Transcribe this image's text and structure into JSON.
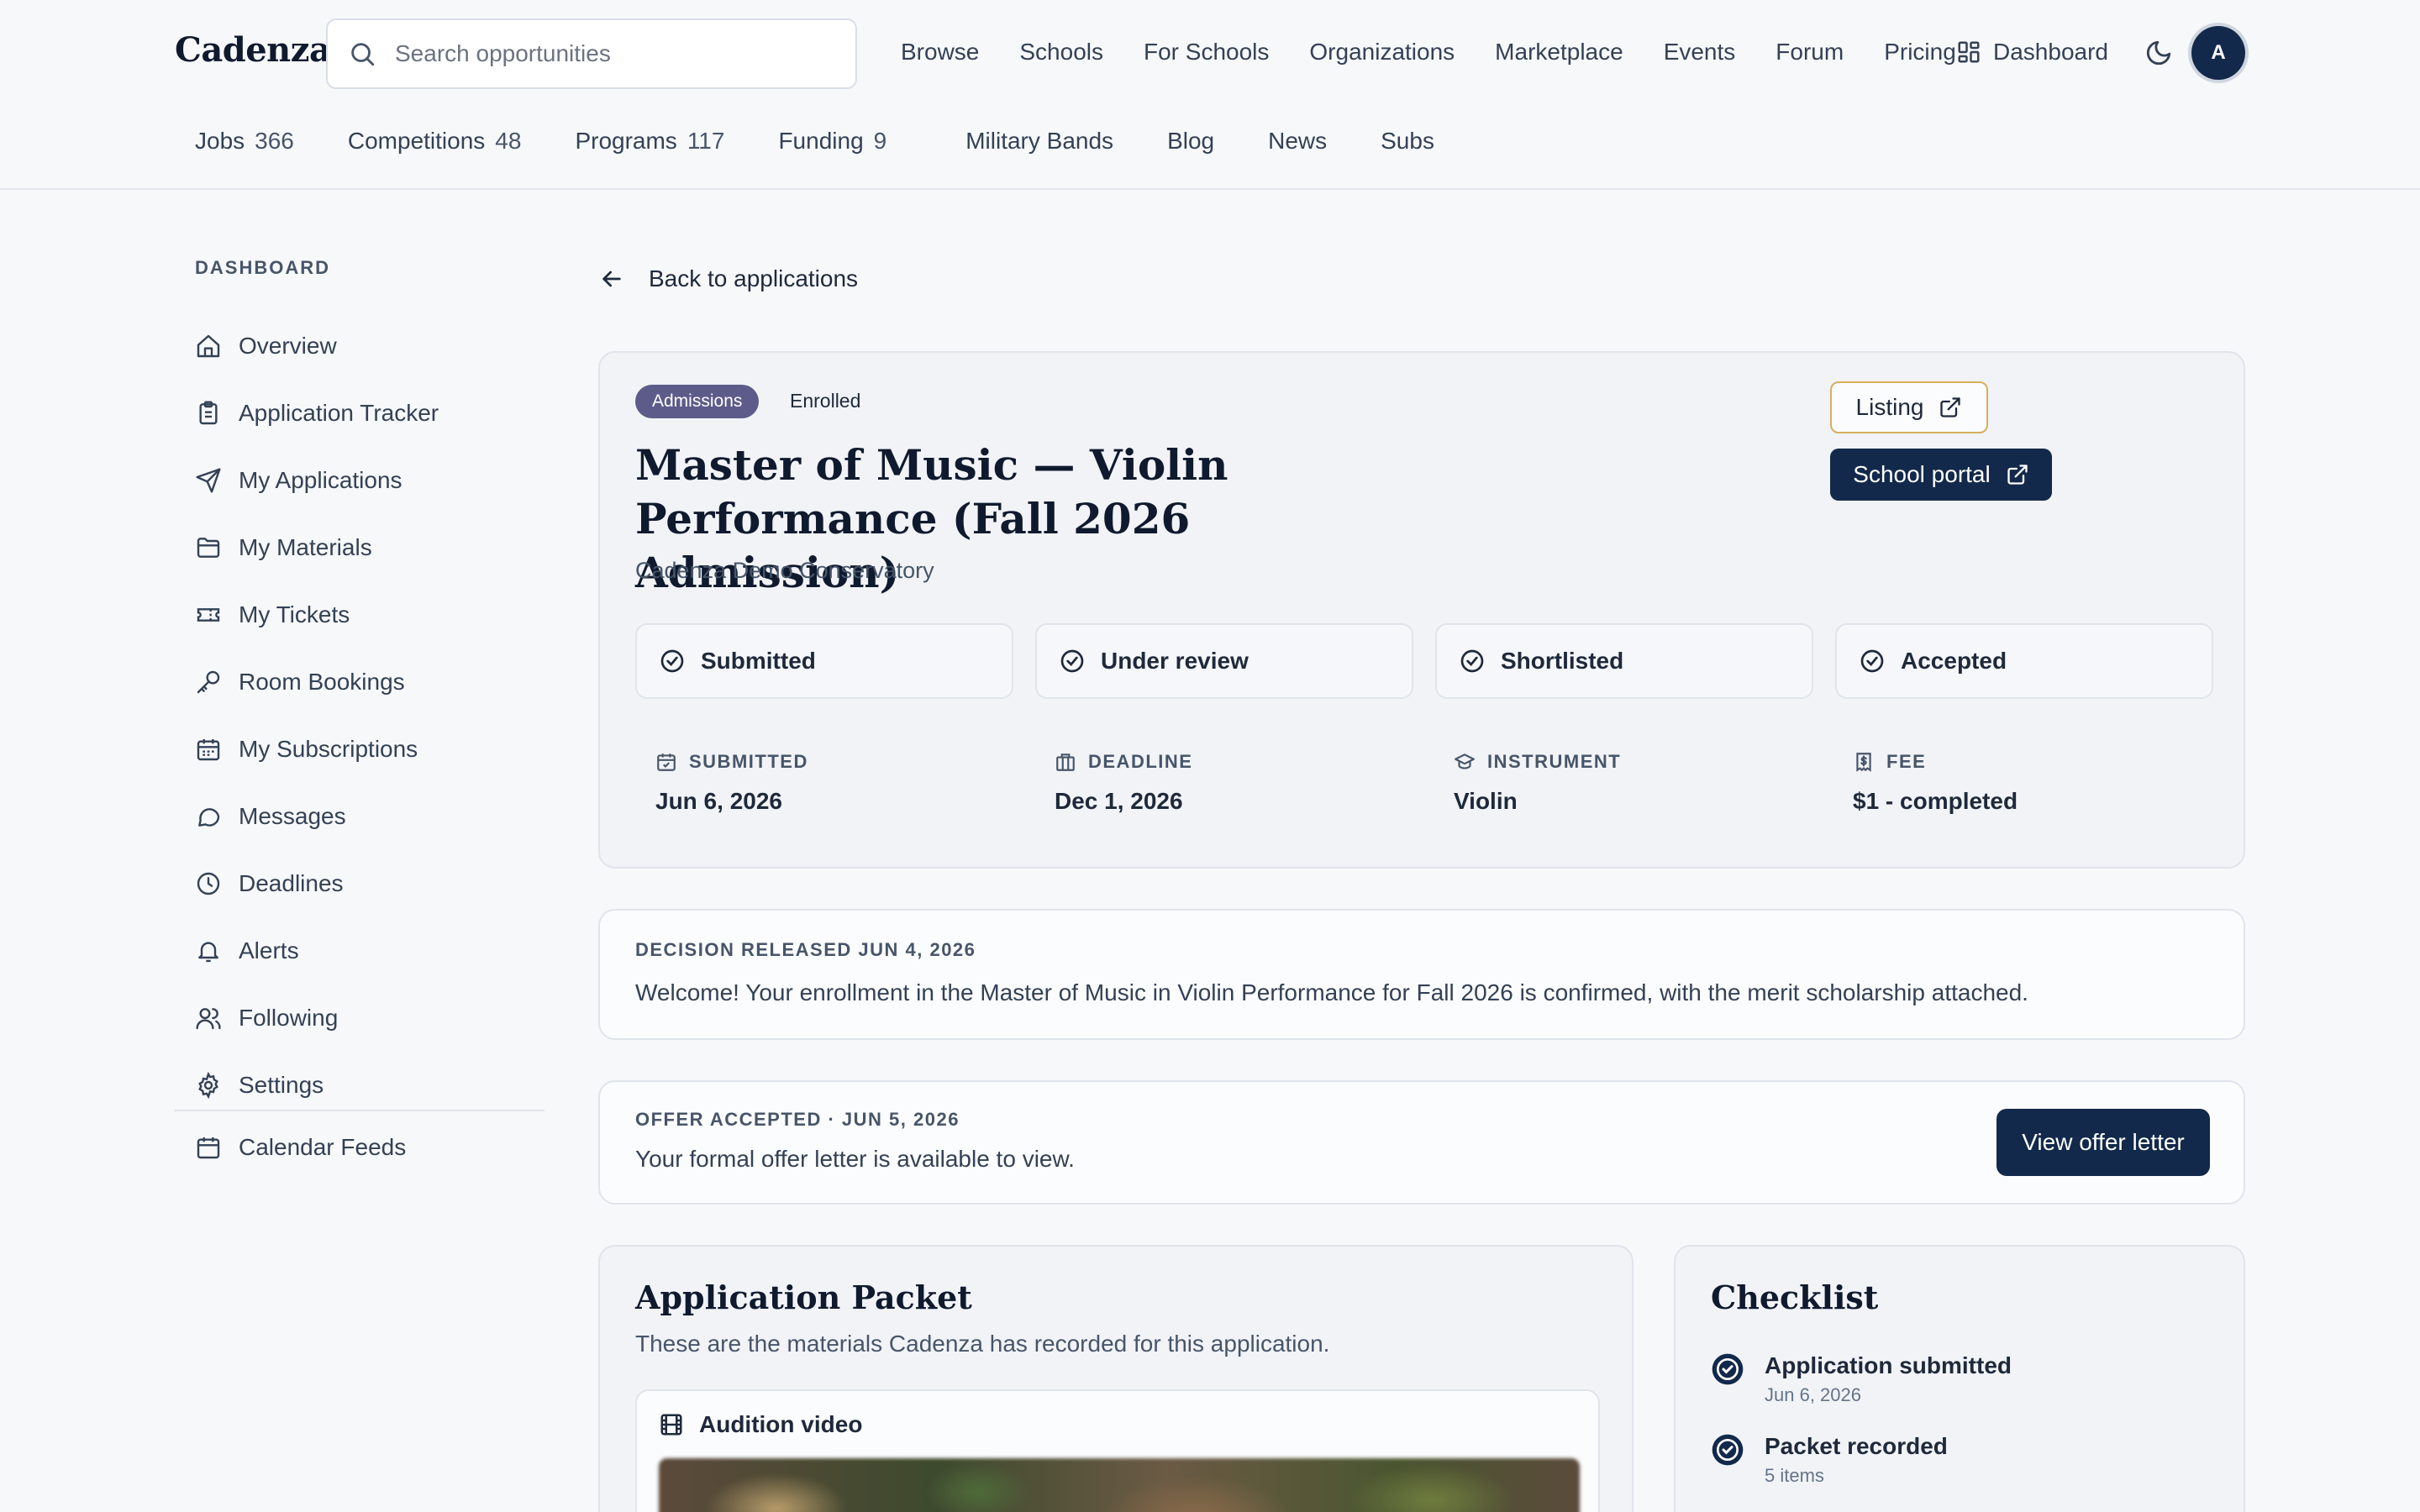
{
  "header": {
    "logo": "Cadenza",
    "search_placeholder": "Search opportunities",
    "nav": [
      "Browse",
      "Schools",
      "For Schools",
      "Organizations",
      "Marketplace",
      "Events",
      "Forum",
      "Pricing"
    ],
    "dashboard_label": "Dashboard",
    "avatar_initial": "A"
  },
  "subnav": {
    "jobs": {
      "label": "Jobs",
      "count": "366"
    },
    "competitions": {
      "label": "Competitions",
      "count": "48"
    },
    "programs": {
      "label": "Programs",
      "count": "117"
    },
    "funding": {
      "label": "Funding",
      "count": "9"
    },
    "links": [
      "Military Bands",
      "Blog",
      "News",
      "Subs"
    ]
  },
  "sidebar": {
    "title": "DASHBOARD",
    "items": [
      {
        "label": "Overview",
        "icon": "home-icon"
      },
      {
        "label": "Application Tracker",
        "icon": "clipboard-icon"
      },
      {
        "label": "My Applications",
        "icon": "send-icon"
      },
      {
        "label": "My Materials",
        "icon": "folder-icon"
      },
      {
        "label": "My Tickets",
        "icon": "ticket-icon"
      },
      {
        "label": "Room Bookings",
        "icon": "key-icon"
      },
      {
        "label": "My Subscriptions",
        "icon": "calendar-icon"
      },
      {
        "label": "Messages",
        "icon": "chat-icon"
      },
      {
        "label": "Deadlines",
        "icon": "clock-icon"
      },
      {
        "label": "Alerts",
        "icon": "bell-icon"
      },
      {
        "label": "Following",
        "icon": "users-icon"
      },
      {
        "label": "Settings",
        "icon": "gear-icon"
      }
    ],
    "calendar_feeds": "Calendar Feeds"
  },
  "main": {
    "back_label": "Back to applications",
    "badge": "Admissions",
    "status": "Enrolled",
    "title": "Master of Music — Violin Performance (Fall 2026 Admission)",
    "school": "Cadenza Demo Conservatory",
    "listing_label": "Listing",
    "portal_label": "School portal",
    "stages": [
      "Submitted",
      "Under review",
      "Shortlisted",
      "Accepted"
    ],
    "meta": {
      "submitted": {
        "label": "SUBMITTED",
        "value": "Jun 6, 2026"
      },
      "deadline": {
        "label": "DEADLINE",
        "value": "Dec 1, 2026"
      },
      "instrument": {
        "label": "INSTRUMENT",
        "value": "Violin"
      },
      "fee": {
        "label": "FEE",
        "value": "$1 - completed"
      }
    },
    "decision": {
      "caption": "DECISION RELEASED JUN 4, 2026",
      "text": "Welcome! Your enrollment in the Master of Music in Violin Performance for Fall 2026 is confirmed, with the merit scholarship attached."
    },
    "offer": {
      "caption": "OFFER ACCEPTED · JUN 5, 2026",
      "text": "Your formal offer letter is available to view.",
      "button": "View offer letter"
    },
    "packet": {
      "title": "Application Packet",
      "desc": "These are the materials Cadenza has recorded for this application.",
      "video_label": "Audition video"
    },
    "checklist": {
      "title": "Checklist",
      "items": [
        {
          "title": "Application submitted",
          "sub": "Jun 6, 2026"
        },
        {
          "title": "Packet recorded",
          "sub": "5 items"
        }
      ]
    }
  },
  "colors": {
    "navy": "#13294b",
    "badge_purple": "#5d5b8a",
    "listing_border": "#d8b05a"
  }
}
